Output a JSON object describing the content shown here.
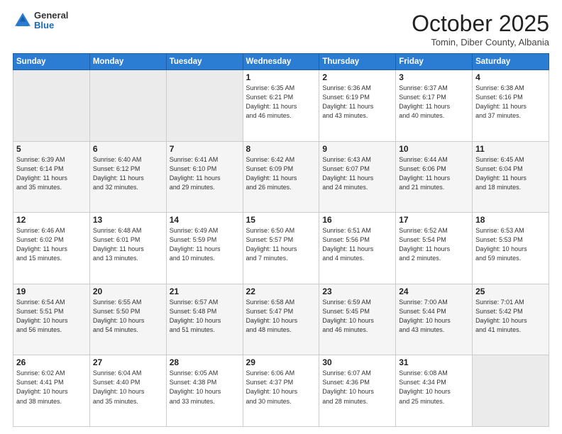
{
  "logo": {
    "general": "General",
    "blue": "Blue"
  },
  "title": "October 2025",
  "location": "Tomin, Diber County, Albania",
  "weekdays": [
    "Sunday",
    "Monday",
    "Tuesday",
    "Wednesday",
    "Thursday",
    "Friday",
    "Saturday"
  ],
  "weeks": [
    [
      {
        "num": "",
        "info": ""
      },
      {
        "num": "",
        "info": ""
      },
      {
        "num": "",
        "info": ""
      },
      {
        "num": "1",
        "info": "Sunrise: 6:35 AM\nSunset: 6:21 PM\nDaylight: 11 hours\nand 46 minutes."
      },
      {
        "num": "2",
        "info": "Sunrise: 6:36 AM\nSunset: 6:19 PM\nDaylight: 11 hours\nand 43 minutes."
      },
      {
        "num": "3",
        "info": "Sunrise: 6:37 AM\nSunset: 6:17 PM\nDaylight: 11 hours\nand 40 minutes."
      },
      {
        "num": "4",
        "info": "Sunrise: 6:38 AM\nSunset: 6:16 PM\nDaylight: 11 hours\nand 37 minutes."
      }
    ],
    [
      {
        "num": "5",
        "info": "Sunrise: 6:39 AM\nSunset: 6:14 PM\nDaylight: 11 hours\nand 35 minutes."
      },
      {
        "num": "6",
        "info": "Sunrise: 6:40 AM\nSunset: 6:12 PM\nDaylight: 11 hours\nand 32 minutes."
      },
      {
        "num": "7",
        "info": "Sunrise: 6:41 AM\nSunset: 6:10 PM\nDaylight: 11 hours\nand 29 minutes."
      },
      {
        "num": "8",
        "info": "Sunrise: 6:42 AM\nSunset: 6:09 PM\nDaylight: 11 hours\nand 26 minutes."
      },
      {
        "num": "9",
        "info": "Sunrise: 6:43 AM\nSunset: 6:07 PM\nDaylight: 11 hours\nand 24 minutes."
      },
      {
        "num": "10",
        "info": "Sunrise: 6:44 AM\nSunset: 6:06 PM\nDaylight: 11 hours\nand 21 minutes."
      },
      {
        "num": "11",
        "info": "Sunrise: 6:45 AM\nSunset: 6:04 PM\nDaylight: 11 hours\nand 18 minutes."
      }
    ],
    [
      {
        "num": "12",
        "info": "Sunrise: 6:46 AM\nSunset: 6:02 PM\nDaylight: 11 hours\nand 15 minutes."
      },
      {
        "num": "13",
        "info": "Sunrise: 6:48 AM\nSunset: 6:01 PM\nDaylight: 11 hours\nand 13 minutes."
      },
      {
        "num": "14",
        "info": "Sunrise: 6:49 AM\nSunset: 5:59 PM\nDaylight: 11 hours\nand 10 minutes."
      },
      {
        "num": "15",
        "info": "Sunrise: 6:50 AM\nSunset: 5:57 PM\nDaylight: 11 hours\nand 7 minutes."
      },
      {
        "num": "16",
        "info": "Sunrise: 6:51 AM\nSunset: 5:56 PM\nDaylight: 11 hours\nand 4 minutes."
      },
      {
        "num": "17",
        "info": "Sunrise: 6:52 AM\nSunset: 5:54 PM\nDaylight: 11 hours\nand 2 minutes."
      },
      {
        "num": "18",
        "info": "Sunrise: 6:53 AM\nSunset: 5:53 PM\nDaylight: 10 hours\nand 59 minutes."
      }
    ],
    [
      {
        "num": "19",
        "info": "Sunrise: 6:54 AM\nSunset: 5:51 PM\nDaylight: 10 hours\nand 56 minutes."
      },
      {
        "num": "20",
        "info": "Sunrise: 6:55 AM\nSunset: 5:50 PM\nDaylight: 10 hours\nand 54 minutes."
      },
      {
        "num": "21",
        "info": "Sunrise: 6:57 AM\nSunset: 5:48 PM\nDaylight: 10 hours\nand 51 minutes."
      },
      {
        "num": "22",
        "info": "Sunrise: 6:58 AM\nSunset: 5:47 PM\nDaylight: 10 hours\nand 48 minutes."
      },
      {
        "num": "23",
        "info": "Sunrise: 6:59 AM\nSunset: 5:45 PM\nDaylight: 10 hours\nand 46 minutes."
      },
      {
        "num": "24",
        "info": "Sunrise: 7:00 AM\nSunset: 5:44 PM\nDaylight: 10 hours\nand 43 minutes."
      },
      {
        "num": "25",
        "info": "Sunrise: 7:01 AM\nSunset: 5:42 PM\nDaylight: 10 hours\nand 41 minutes."
      }
    ],
    [
      {
        "num": "26",
        "info": "Sunrise: 6:02 AM\nSunset: 4:41 PM\nDaylight: 10 hours\nand 38 minutes."
      },
      {
        "num": "27",
        "info": "Sunrise: 6:04 AM\nSunset: 4:40 PM\nDaylight: 10 hours\nand 35 minutes."
      },
      {
        "num": "28",
        "info": "Sunrise: 6:05 AM\nSunset: 4:38 PM\nDaylight: 10 hours\nand 33 minutes."
      },
      {
        "num": "29",
        "info": "Sunrise: 6:06 AM\nSunset: 4:37 PM\nDaylight: 10 hours\nand 30 minutes."
      },
      {
        "num": "30",
        "info": "Sunrise: 6:07 AM\nSunset: 4:36 PM\nDaylight: 10 hours\nand 28 minutes."
      },
      {
        "num": "31",
        "info": "Sunrise: 6:08 AM\nSunset: 4:34 PM\nDaylight: 10 hours\nand 25 minutes."
      },
      {
        "num": "",
        "info": ""
      }
    ]
  ]
}
